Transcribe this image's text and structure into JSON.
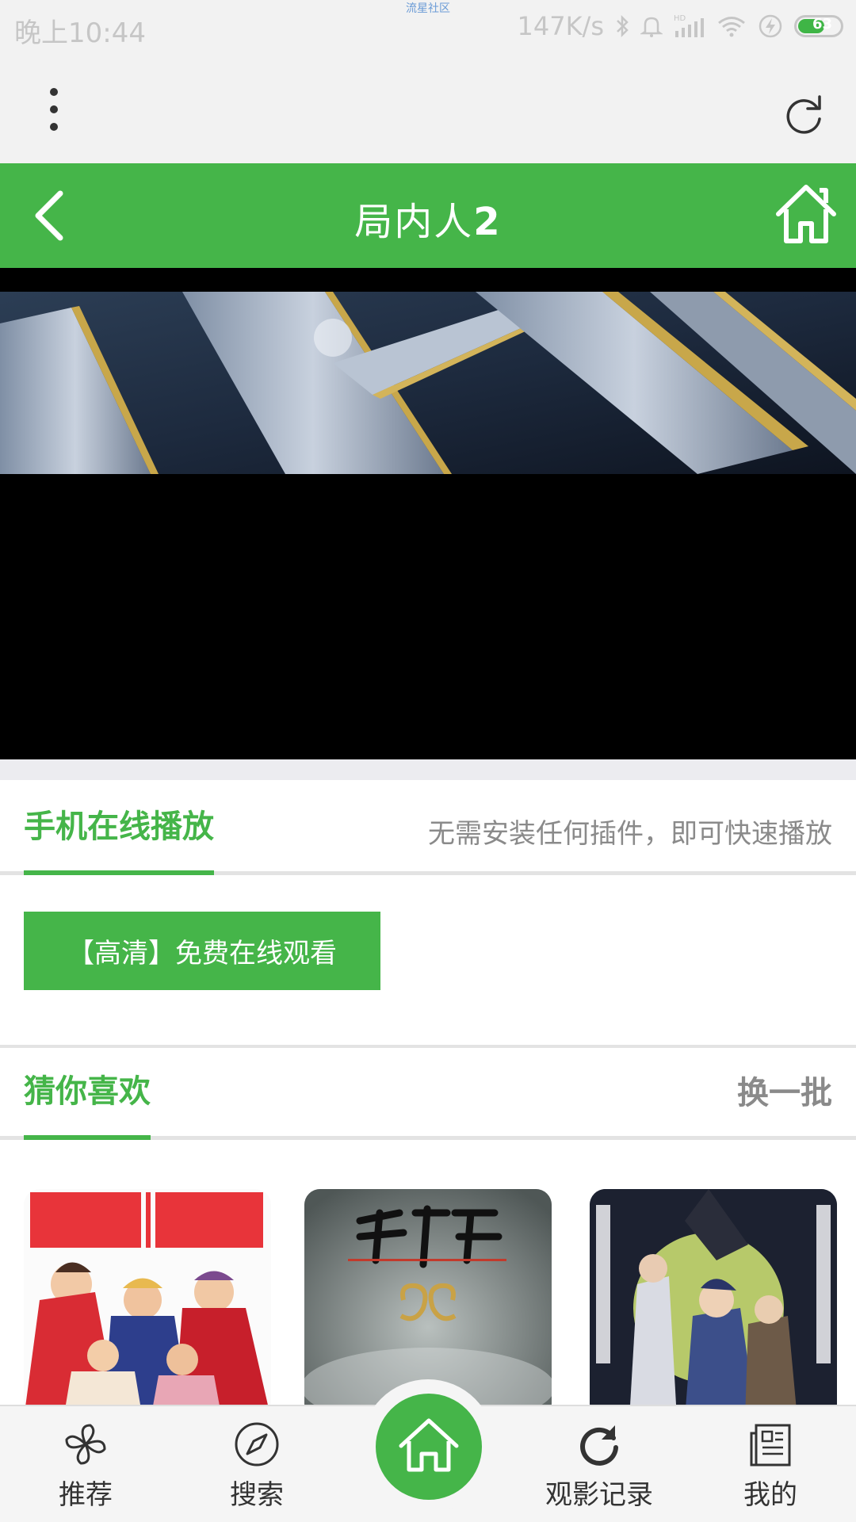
{
  "status_bar": {
    "time": "晚上10:44",
    "app_name": "流星社区",
    "net_speed": "147K/s",
    "network": "HD",
    "battery": "63",
    "battery_level": 0.63
  },
  "browser": {
    "menu_icon": "more-vertical-icon",
    "refresh_icon": "refresh-icon"
  },
  "header": {
    "title": "局内人",
    "title_suffix": "2",
    "back_icon": "chevron-left-icon",
    "home_icon": "home-icon",
    "color": "#45b549"
  },
  "online": {
    "title": "手机在线播放",
    "hint": "无需安装任何插件，即可快速播放",
    "watch_button": "【高清】免费在线观看"
  },
  "recommend": {
    "title": "猜你喜欢",
    "refresh": "换一批"
  },
  "bottom_nav": {
    "items": [
      {
        "label": "推荐",
        "icon": "pinwheel-icon"
      },
      {
        "label": "搜索",
        "icon": "compass-icon"
      },
      {
        "label": "",
        "icon": "home-icon"
      },
      {
        "label": "观影记录",
        "icon": "history-icon"
      },
      {
        "label": "我的",
        "icon": "profile-icon"
      }
    ]
  }
}
